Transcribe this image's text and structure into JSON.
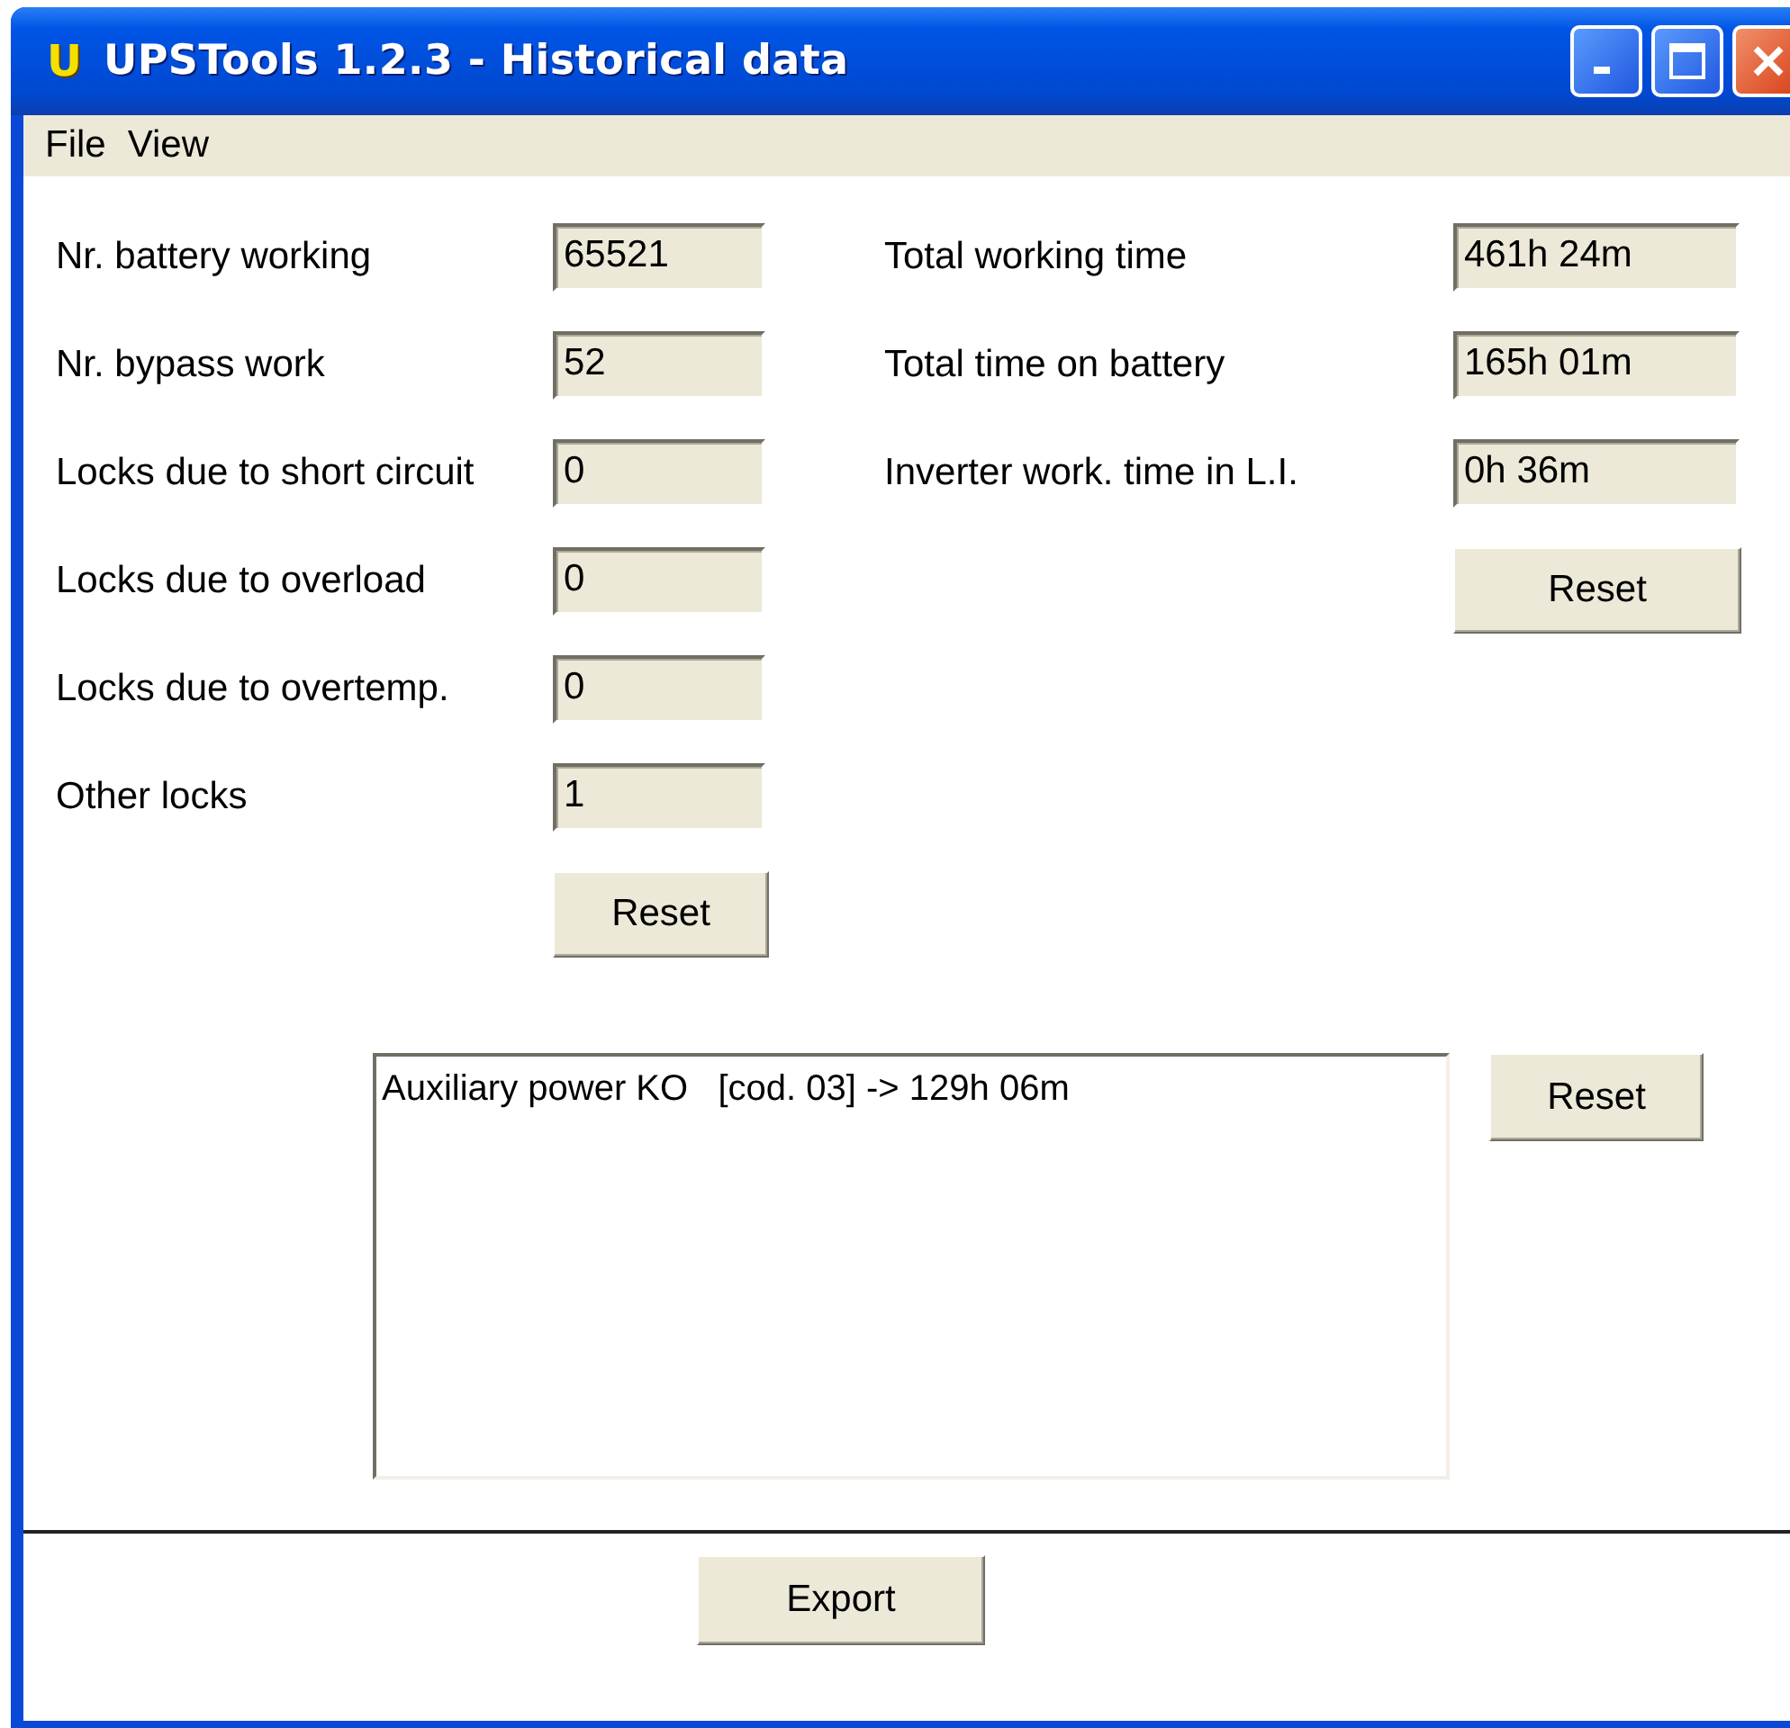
{
  "window": {
    "icon_letter": "U",
    "title": "UPSTools 1.2.3 - Historical data"
  },
  "menu": [
    {
      "label": "File"
    },
    {
      "label": "View"
    }
  ],
  "counters": [
    {
      "label": "Nr. battery working",
      "value": "65521"
    },
    {
      "label": "Nr. bypass work",
      "value": "52"
    },
    {
      "label": "Locks due to short circuit",
      "value": "0"
    },
    {
      "label": "Locks due to overload",
      "value": "0"
    },
    {
      "label": "Locks due to overtemp.",
      "value": "0"
    },
    {
      "label": "Other locks",
      "value": "1"
    }
  ],
  "counters_reset": "Reset",
  "times": [
    {
      "label": "Total working time",
      "value": "461h 24m"
    },
    {
      "label": "Total time on battery",
      "value": "165h 01m"
    },
    {
      "label": "Inverter work. time in L.I.",
      "value": "0h 36m"
    }
  ],
  "times_reset": "Reset",
  "log": {
    "lines": [
      "Auxiliary power KO   [cod. 03] -> 129h 06m"
    ],
    "reset": "Reset"
  },
  "export": "Export"
}
